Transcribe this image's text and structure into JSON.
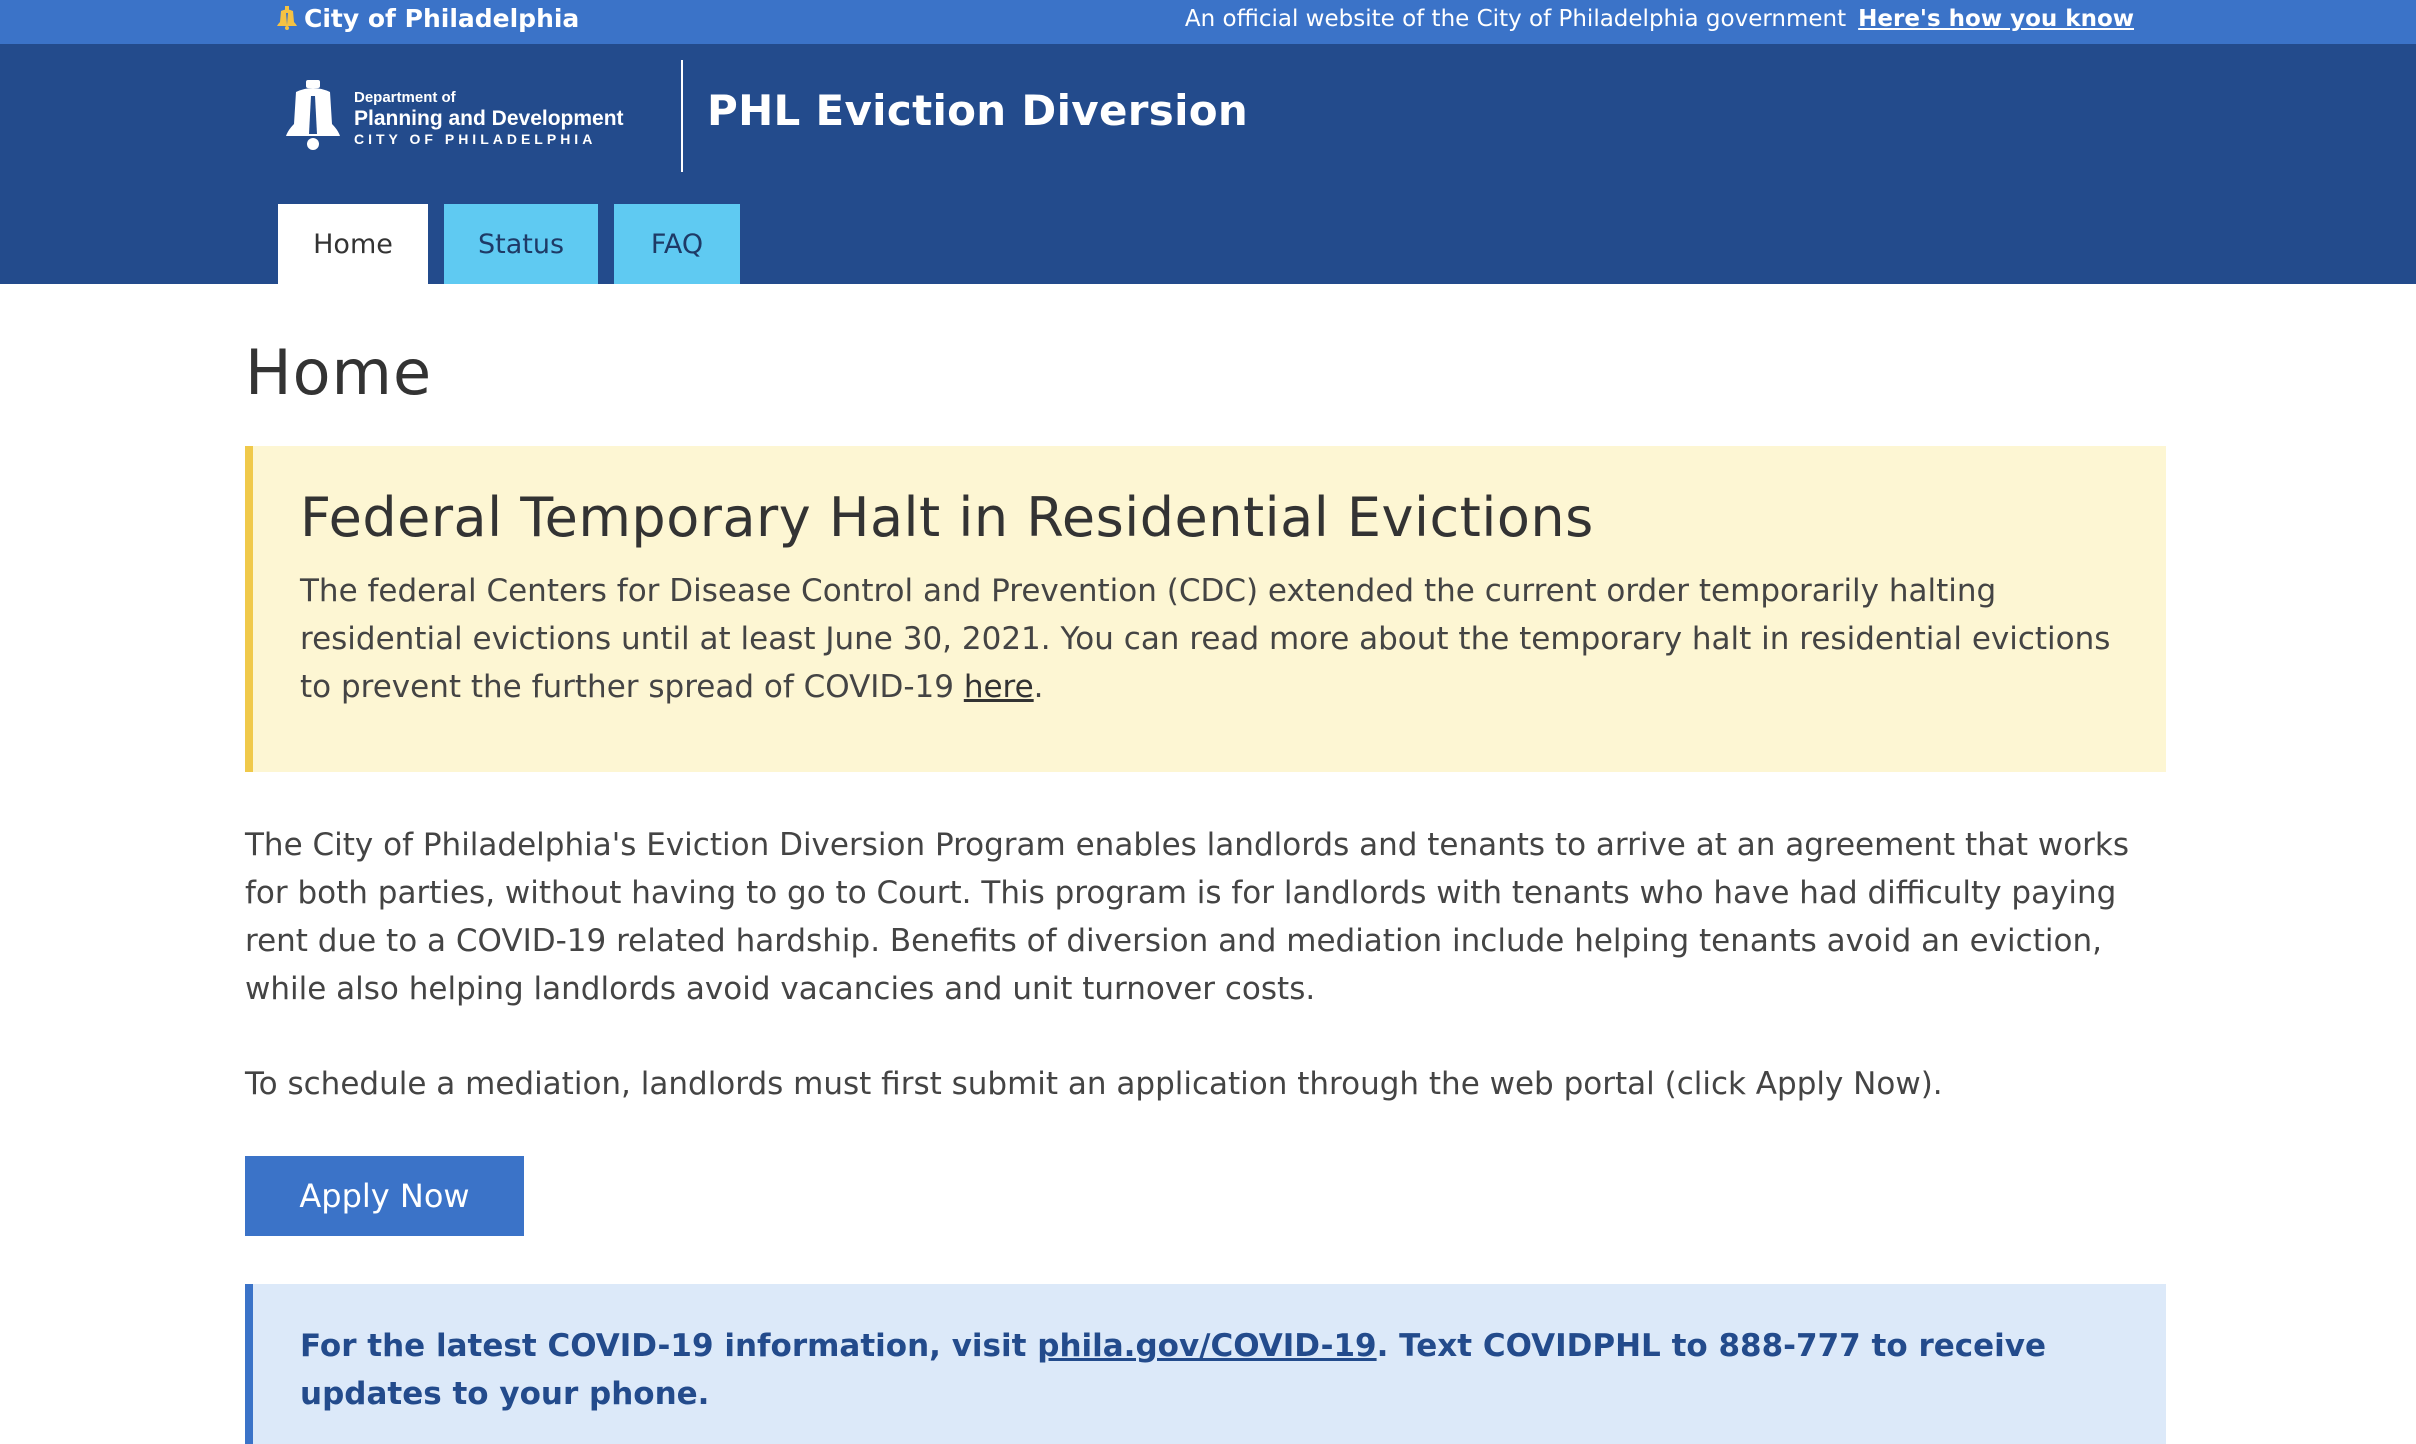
{
  "topbar": {
    "city_label": "City of Philadelphia",
    "official_text": "An official website of the City of Philadelphia government",
    "how_link": "Here's how you know"
  },
  "header": {
    "logo": {
      "line1": "Department of",
      "line2": "Planning and Development",
      "line3": "CITY OF PHILADELPHIA"
    },
    "site_title": "PHL Eviction Diversion"
  },
  "nav": {
    "tabs": [
      {
        "label": "Home",
        "active": true
      },
      {
        "label": "Status",
        "active": false
      },
      {
        "label": "FAQ",
        "active": false
      }
    ]
  },
  "main": {
    "page_title": "Home",
    "notice": {
      "heading": "Federal Temporary Halt in Residential Evictions",
      "body": "The federal Centers for Disease Control and Prevention (CDC) extended the current order temporarily halting residential evictions until at least June 30, 2021. You can read more about the temporary halt in residential evictions to prevent the further spread of COVID-19 ",
      "link": "here",
      "end": "."
    },
    "intro": "The City of Philadelphia's Eviction Diversion Program enables landlords and tenants to arrive at an agreement that works for both parties, without having to go to Court. This program is for landlords with tenants who have had difficulty paying rent due to a COVID-19 related hardship. Benefits of diversion and mediation include helping tenants avoid an eviction, while also helping landlords avoid vacancies and unit turnover costs.",
    "schedule": "To schedule a mediation, landlords must first submit an application through the web portal (click Apply Now).",
    "apply_label": "Apply Now",
    "covid_info": {
      "before": "For the latest COVID-19 information, visit ",
      "link": "phila.gov/COVID-19",
      "after": ". Text COVIDPHL to 888-777 to receive updates to your phone."
    }
  },
  "colors": {
    "topbar": "#3b73c8",
    "header": "#234b8c",
    "tab_inactive": "#5fcaf2",
    "notice_bg": "#fdf6d3",
    "notice_border": "#f0c94a",
    "info_bg": "#dce9f9",
    "button": "#3b73c8"
  },
  "icons": {
    "city_logo": "liberty-bell-icon",
    "dept_logo": "liberty-bell-icon"
  }
}
